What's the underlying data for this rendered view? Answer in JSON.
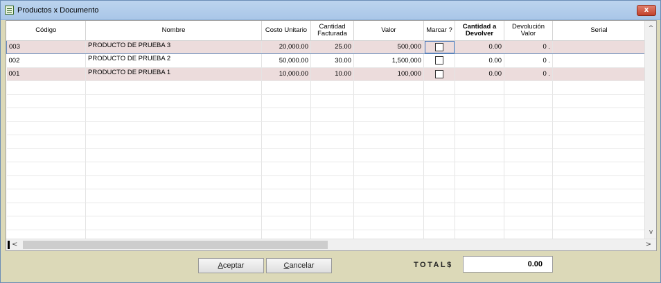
{
  "window": {
    "title": "Productos x Documento",
    "close_label": "x"
  },
  "grid": {
    "headers": [
      "Código",
      "Nombre",
      "Costo Unitario",
      "Cantidad\nFacturada",
      "Valor",
      "Marcar ?",
      "Cantidad a Devolver",
      "Devolución Valor",
      "Serial"
    ],
    "rows": [
      {
        "codigo": "003",
        "nombre": "PRODUCTO DE PRUEBA 3",
        "costo": "20,000.00",
        "cantidad": "25.00",
        "valor": "500,000",
        "marcar": false,
        "cant_devolver": "0.00",
        "dev_valor": "0 .",
        "serial": ""
      },
      {
        "codigo": "002",
        "nombre": "PRODUCTO DE PRUEBA 2",
        "costo": "50,000.00",
        "cantidad": "30.00",
        "valor": "1,500,000",
        "marcar": false,
        "cant_devolver": "0.00",
        "dev_valor": "0 .",
        "serial": ""
      },
      {
        "codigo": "001",
        "nombre": "PRODUCTO DE PRUEBA 1",
        "costo": "10,000.00",
        "cantidad": "10.00",
        "valor": "100,000",
        "marcar": false,
        "cant_devolver": "0.00",
        "dev_valor": "0 .",
        "serial": ""
      }
    ]
  },
  "scroll": {
    "up": "^",
    "down": "v",
    "left": "<",
    "right": ">"
  },
  "footer": {
    "accept_first": "A",
    "accept_rest": "ceptar",
    "cancel_first": "C",
    "cancel_rest": "ancelar",
    "totals_label": "TOTAL$",
    "totals_value": "0.00"
  },
  "colors": {
    "pink_row": "#ecdcdc",
    "frame": "#dcd9b8",
    "title": "#a9c6e8"
  },
  "icons": [
    "app-icon",
    "close-icon",
    "checkbox"
  ]
}
